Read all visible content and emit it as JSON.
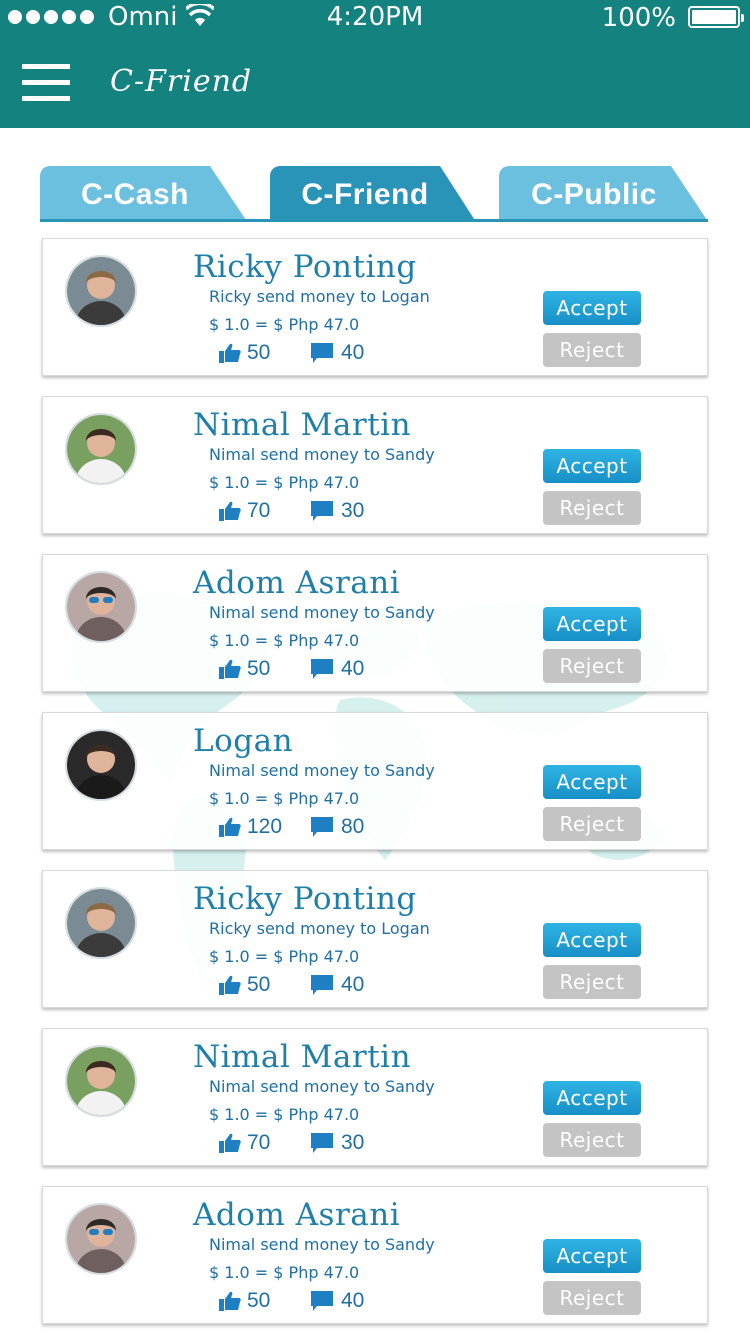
{
  "status_bar": {
    "carrier": "Omni",
    "time": "4:20PM",
    "battery": "100%"
  },
  "nav": {
    "title": "C-Friend"
  },
  "tabs": [
    {
      "label": "C-Cash",
      "active": false
    },
    {
      "label": "C-Friend",
      "active": true
    },
    {
      "label": "C-Public",
      "active": false
    }
  ],
  "colors": {
    "header": "#14827f",
    "tab": "#6cc0df",
    "tab_active": "#2a93b8",
    "accept": "#1f9fd6",
    "reject": "#c4c4c4",
    "text": "#1f7fa8"
  },
  "requests": [
    {
      "name": "Ricky Ponting",
      "message": "Ricky send money to Logan",
      "amount": "$ 1.0 = $ Php 47.0",
      "likes": "50",
      "comments": "40",
      "accept_label": "Accept",
      "reject_label": "Reject",
      "avatar_icon": "man-avatar-icon"
    },
    {
      "name": "Nimal Martin",
      "message": "Nimal send money to Sandy",
      "amount": "$ 1.0 = $ Php 47.0",
      "likes": "70",
      "comments": "30",
      "accept_label": "Accept",
      "reject_label": "Reject",
      "avatar_icon": "woman-avatar-icon"
    },
    {
      "name": "Adom Asrani",
      "message": "Nimal send money to Sandy",
      "amount": "$ 1.0 = $ Php 47.0",
      "likes": "50",
      "comments": "40",
      "accept_label": "Accept",
      "reject_label": "Reject",
      "avatar_icon": "man-sunglasses-avatar-icon"
    },
    {
      "name": "Logan",
      "message": "Nimal send money to Sandy",
      "amount": "$ 1.0 = $ Php 47.0",
      "likes": "120",
      "comments": "80",
      "accept_label": "Accept",
      "reject_label": "Reject",
      "avatar_icon": "bearded-man-avatar-icon"
    },
    {
      "name": "Ricky Ponting",
      "message": "Ricky send money to Logan",
      "amount": "$ 1.0 = $ Php 47.0",
      "likes": "50",
      "comments": "40",
      "accept_label": "Accept",
      "reject_label": "Reject",
      "avatar_icon": "man-avatar-icon"
    },
    {
      "name": "Nimal Martin",
      "message": "Nimal send money to Sandy",
      "amount": "$ 1.0 = $ Php 47.0",
      "likes": "70",
      "comments": "30",
      "accept_label": "Accept",
      "reject_label": "Reject",
      "avatar_icon": "woman-avatar-icon"
    },
    {
      "name": "Adom Asrani",
      "message": "Nimal send money to Sandy",
      "amount": "$ 1.0 = $ Php 47.0",
      "likes": "50",
      "comments": "40",
      "accept_label": "Accept",
      "reject_label": "Reject",
      "avatar_icon": "man-sunglasses-avatar-icon"
    }
  ]
}
